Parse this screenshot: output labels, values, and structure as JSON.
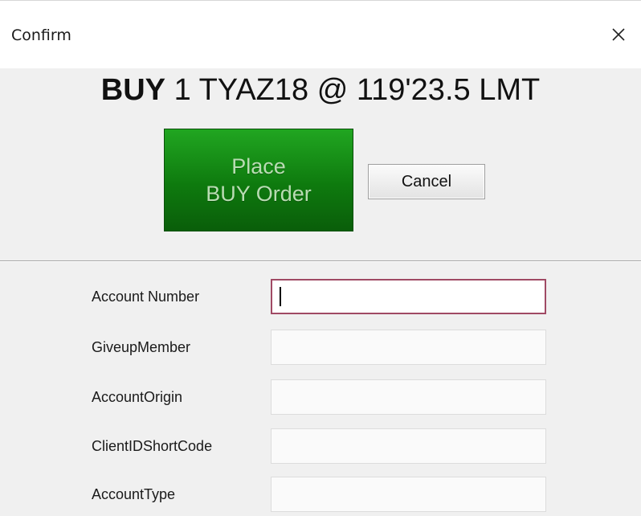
{
  "window": {
    "title": "Confirm",
    "close_icon": "close-icon"
  },
  "order": {
    "side": "BUY",
    "details": "1 TYAZ18 @ 119'23.5 LMT"
  },
  "buttons": {
    "place_line1": "Place",
    "place_line2": "BUY Order",
    "cancel": "Cancel"
  },
  "colors": {
    "buy_green": "#0e7a0e",
    "active_border": "#a04a64"
  },
  "fields": [
    {
      "label": "Account Number",
      "value": "",
      "focused": true
    },
    {
      "label": "GiveupMember",
      "value": ""
    },
    {
      "label": "AccountOrigin",
      "value": ""
    },
    {
      "label": "ClientIDShortCode",
      "value": ""
    },
    {
      "label": "AccountType",
      "value": ""
    }
  ]
}
